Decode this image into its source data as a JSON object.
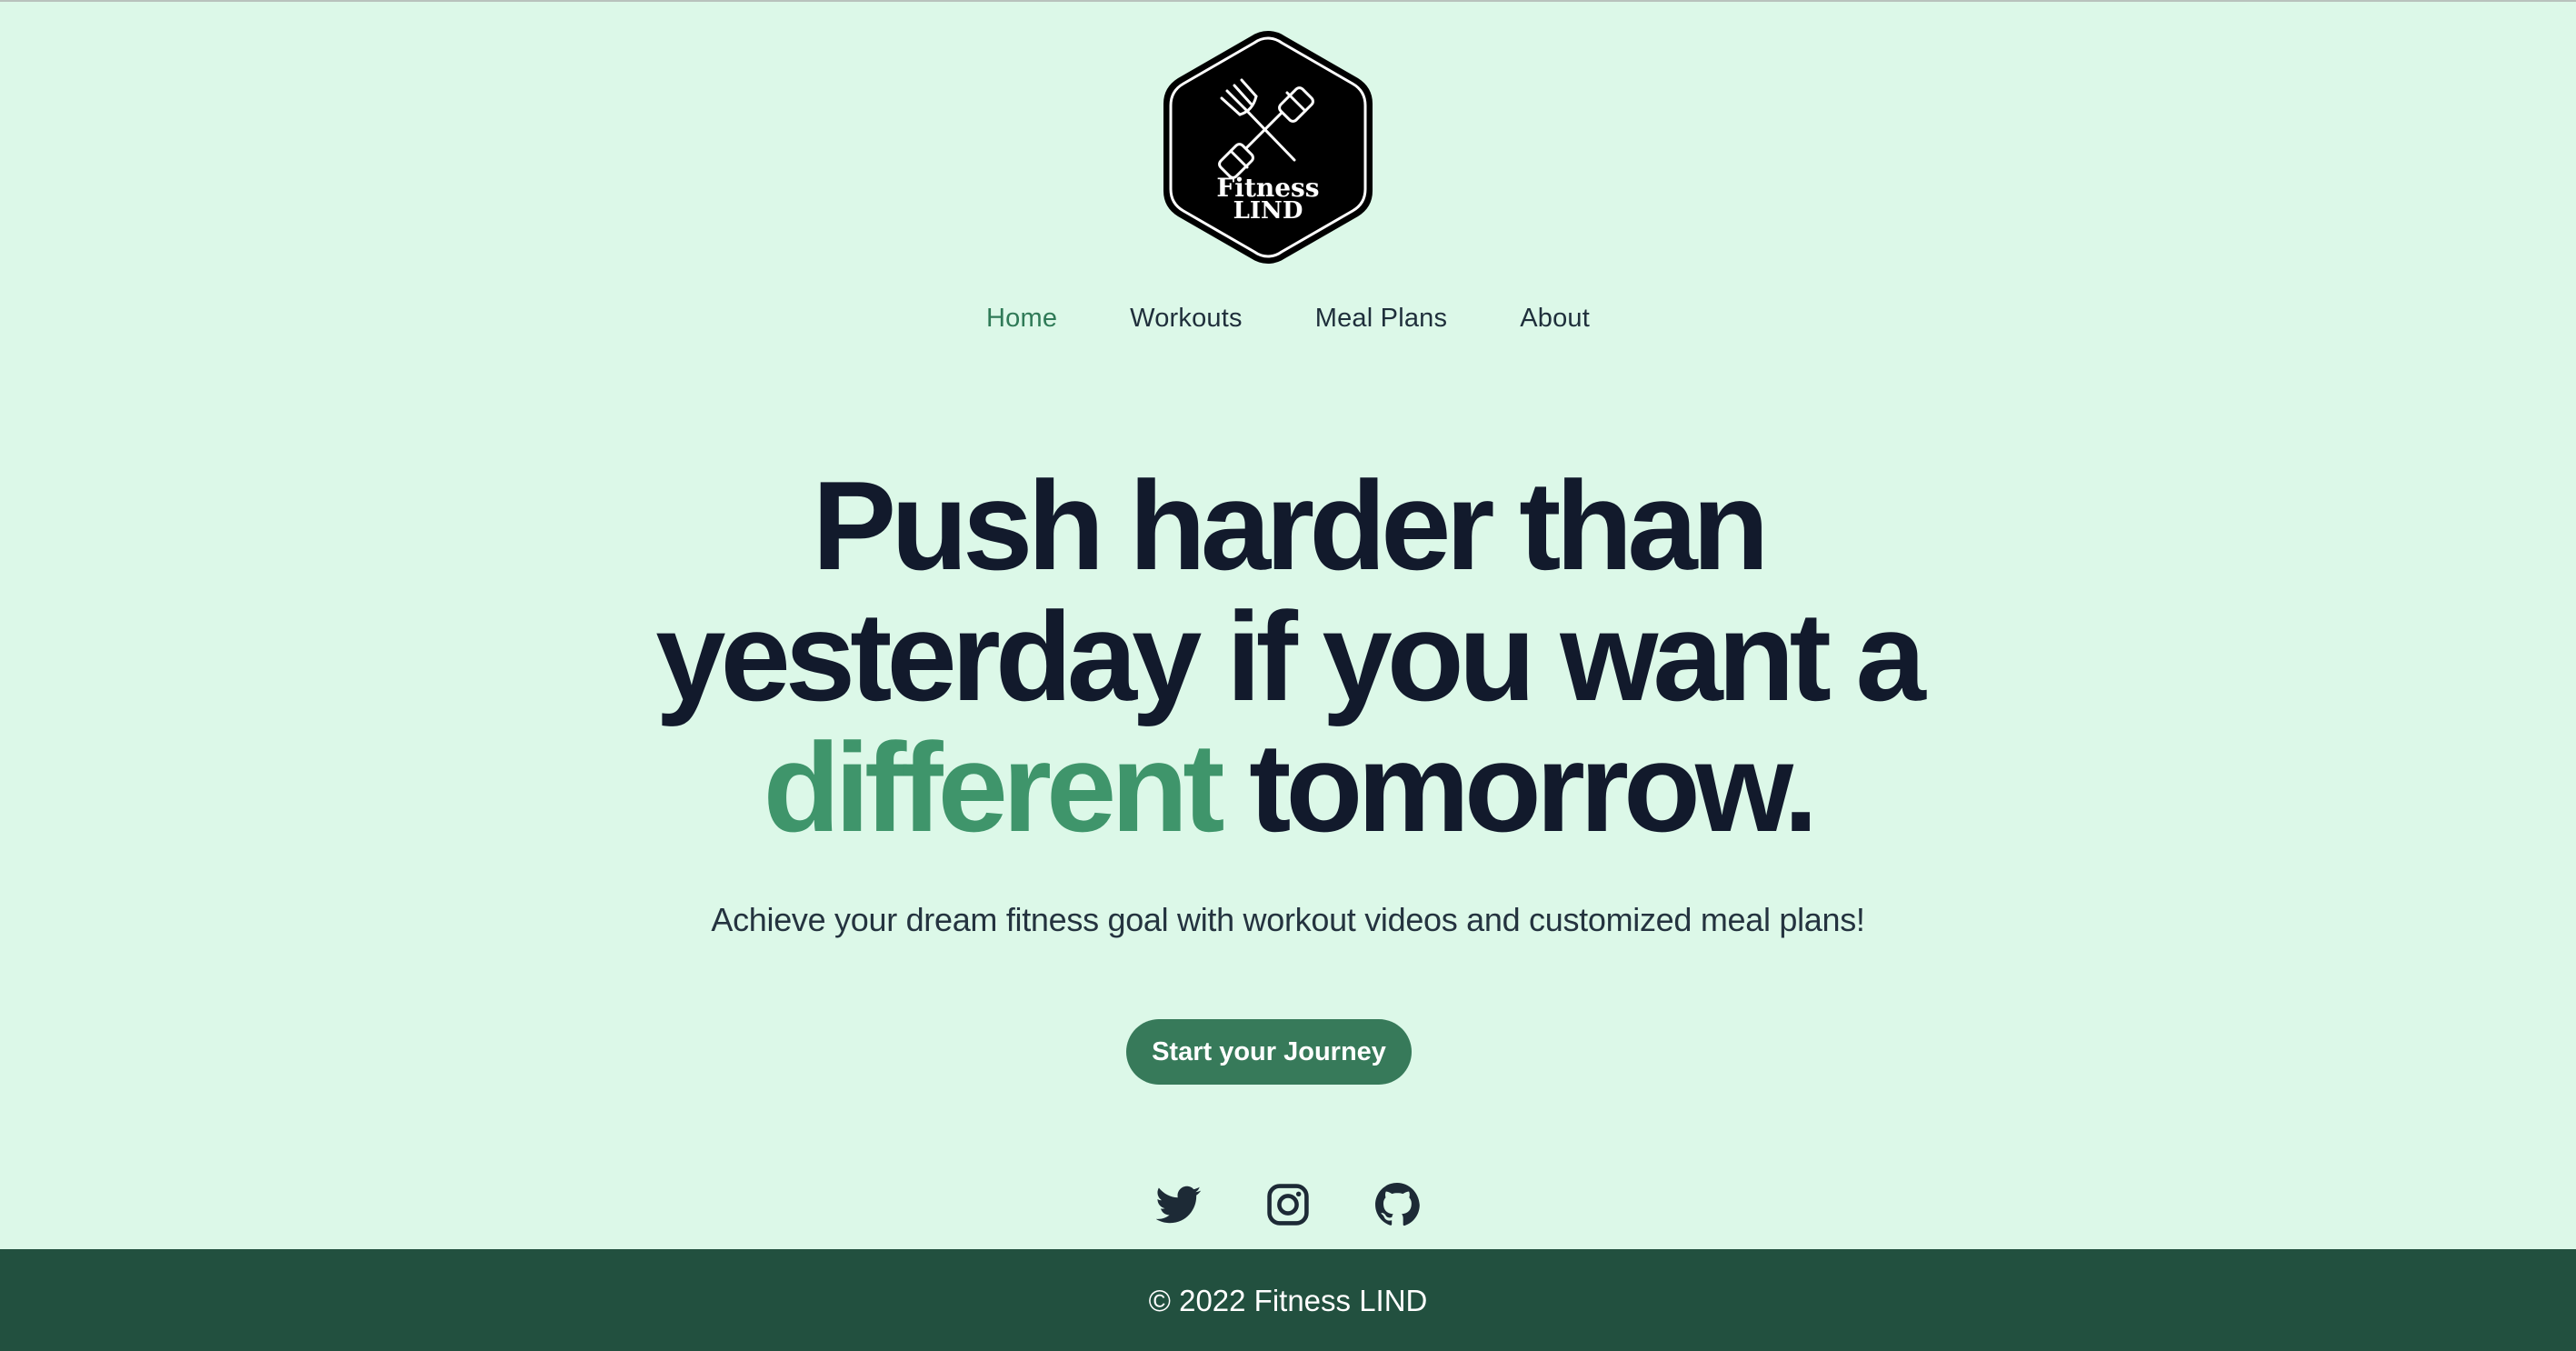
{
  "brand": {
    "logo_line1": "Fitness",
    "logo_line2": "LIND",
    "logo_icon": "crossed-dumbbell-fork-icon"
  },
  "nav": {
    "items": [
      {
        "label": "Home",
        "active": true
      },
      {
        "label": "Workouts",
        "active": false
      },
      {
        "label": "Meal Plans",
        "active": false
      },
      {
        "label": "About",
        "active": false
      }
    ]
  },
  "hero": {
    "headline_line1": "Push harder than",
    "headline_line2": "yesterday if you want a",
    "headline_accent": "different",
    "headline_end": "tomorrow.",
    "subtitle": "Achieve your dream fitness goal with workout videos and customized meal plans!",
    "cta_label": "Start your Journey"
  },
  "socials": [
    {
      "icon": "twitter-icon"
    },
    {
      "icon": "instagram-icon"
    },
    {
      "icon": "github-icon"
    }
  ],
  "footer": {
    "copyright": "© 2022 Fitness LIND"
  },
  "colors": {
    "background": "#dcf8e8",
    "accent": "#3f956b",
    "nav_active": "#2f7a57",
    "button": "#377a5a",
    "footer": "#22503f",
    "text_dark": "#121a2c"
  }
}
